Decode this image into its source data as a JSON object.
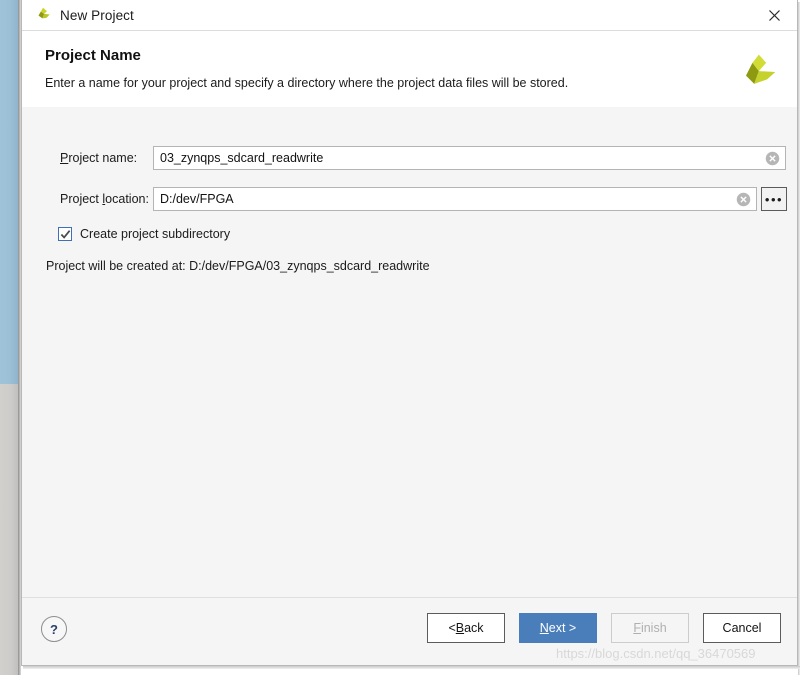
{
  "window": {
    "title": "New Project",
    "icon": "vivado-logo-icon",
    "close_label": "×"
  },
  "header": {
    "title": "Project Name",
    "subtitle": "Enter a name for your project and specify a directory where the project data files will be stored.",
    "logo": "vivado-logo-icon"
  },
  "form": {
    "project_name": {
      "label_prefix": "P",
      "label_rest": "roject name:",
      "value": "03_zynqps_sdcard_readwrite",
      "placeholder": "Project name",
      "clear_icon": "clear-icon"
    },
    "project_location": {
      "label_head": "Project ",
      "label_mn": "l",
      "label_tail": "ocation:",
      "value": "D:/dev/FPGA",
      "placeholder": "Project location",
      "clear_icon": "clear-icon",
      "browse_label": "•••"
    },
    "create_subdirectory": {
      "label": "Create project subdirectory",
      "checked": true
    },
    "created_at_text": "Project will be created at: D:/dev/FPGA/03_zynqps_sdcard_readwrite"
  },
  "footer": {
    "help_label": "?",
    "buttons": [
      {
        "id": "back",
        "pre": "< ",
        "mn": "B",
        "post": "ack",
        "state": "normal"
      },
      {
        "id": "next",
        "pre": "",
        "mn": "N",
        "post": "ext >",
        "state": "primary"
      },
      {
        "id": "finish",
        "pre": "",
        "mn": "F",
        "post": "inish",
        "state": "disabled"
      },
      {
        "id": "cancel",
        "pre": "",
        "mn": "C",
        "post": "ancel",
        "state": "normal"
      }
    ]
  },
  "watermark": "https://blog.csdn.net/qq_36470569",
  "colors": {
    "primary": "#4a7ebb",
    "body_bg": "#f5f5f5",
    "panel_bg": "#ffffff",
    "accent_logo": "#c3cf21",
    "checkbox_border": "#3f6fb5"
  }
}
